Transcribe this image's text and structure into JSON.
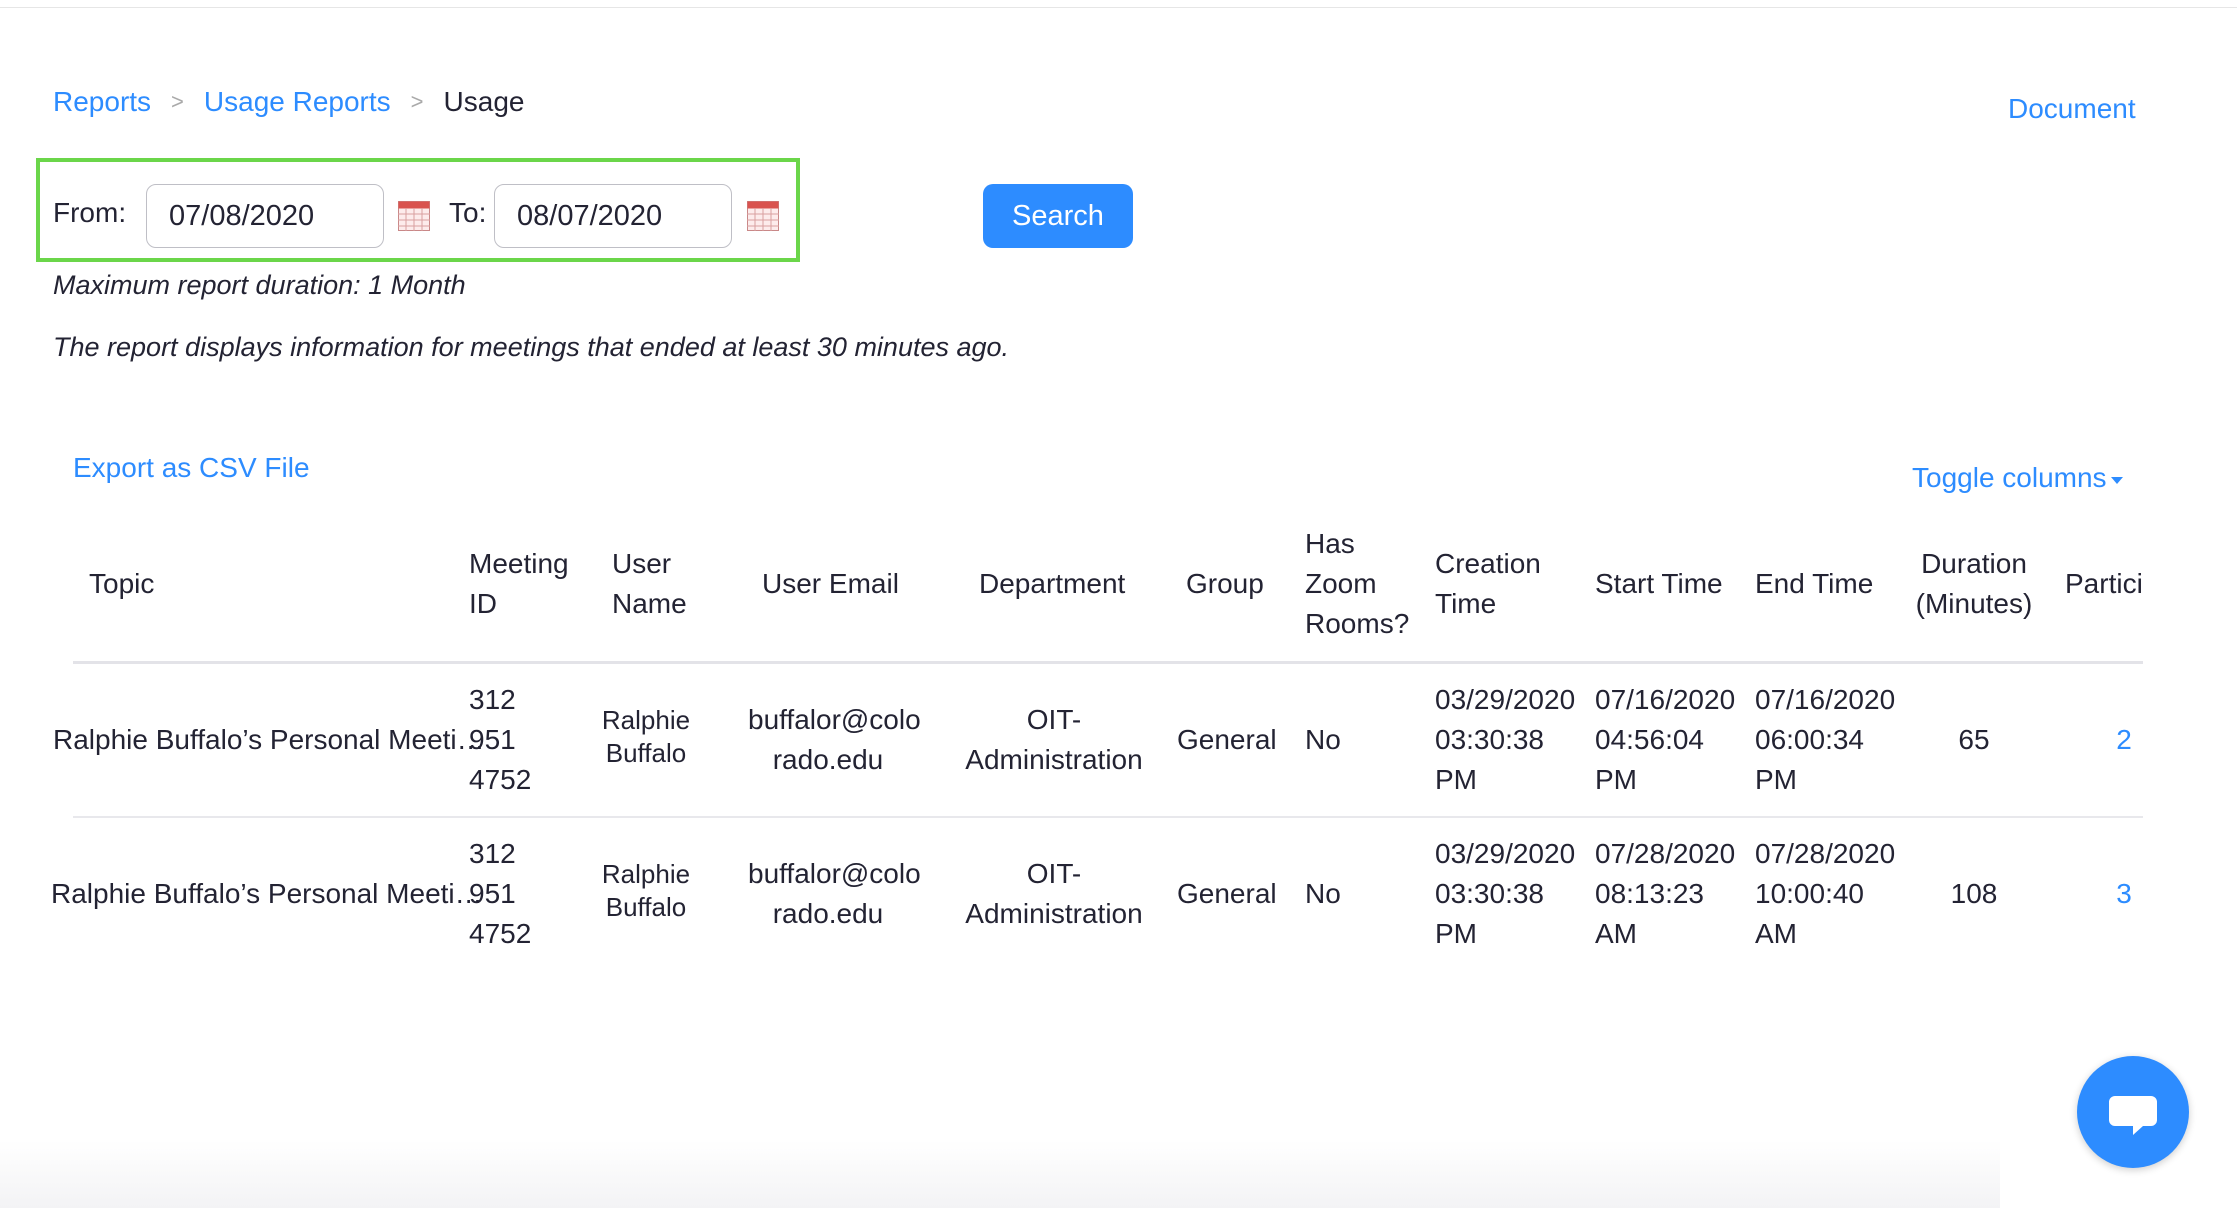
{
  "breadcrumb": {
    "reports": "Reports",
    "usage_reports": "Usage Reports",
    "current": "Usage",
    "separator": ">"
  },
  "document_link": "Document",
  "filter": {
    "from_label": "From:",
    "from_value": "07/08/2020",
    "to_label": "To:",
    "to_value": "08/07/2020",
    "search_label": "Search"
  },
  "notes": {
    "max_duration": "Maximum report duration: 1 Month",
    "ended_info": "The report displays information for meetings that ended at least 30 minutes ago."
  },
  "export_label": "Export as CSV File",
  "toggle_columns_label": "Toggle columns",
  "table": {
    "headers": {
      "topic": "Topic",
      "meeting_id": [
        "Meeting",
        "ID"
      ],
      "user_name": [
        "User",
        "Name"
      ],
      "user_email": "User Email",
      "department": "Department",
      "group": "Group",
      "has_zoom_rooms": [
        "Has",
        "Zoom",
        "Rooms?"
      ],
      "creation_time": [
        "Creation",
        "Time"
      ],
      "start_time": "Start Time",
      "end_time": "End Time",
      "duration": [
        "Duration",
        "(Minutes)"
      ],
      "participants": "Partici"
    },
    "rows": [
      {
        "topic": "Ralphie Buffalo’s Personal Meeti…",
        "meeting_id": [
          "312",
          "951",
          "4752"
        ],
        "user_name": [
          "Ralphie",
          "Buffalo"
        ],
        "user_email": [
          "buffalor@colo",
          "rado.edu"
        ],
        "department": [
          "OIT-",
          "Administration"
        ],
        "group": "General",
        "has_zoom_rooms": "No",
        "creation_time": [
          "03/29/2020",
          "03:30:38",
          "PM"
        ],
        "start_time": [
          "07/16/2020",
          "04:56:04",
          "PM"
        ],
        "end_time": [
          "07/16/2020",
          "06:00:34",
          "PM"
        ],
        "duration": "65",
        "participants": "2"
      },
      {
        "topic": "Ralphie Buffalo’s Personal Meeti…",
        "meeting_id": [
          "312",
          "951",
          "4752"
        ],
        "user_name": [
          "Ralphie",
          "Buffalo"
        ],
        "user_email": [
          "buffalor@colo",
          "rado.edu"
        ],
        "department": [
          "OIT-",
          "Administration"
        ],
        "group": "General",
        "has_zoom_rooms": "No",
        "creation_time": [
          "03/29/2020",
          "03:30:38",
          "PM"
        ],
        "start_time": [
          "07/28/2020",
          "08:13:23",
          "AM"
        ],
        "end_time": [
          "07/28/2020",
          "10:00:40",
          "AM"
        ],
        "duration": "108",
        "participants": "3"
      }
    ]
  },
  "icons": {
    "calendar": "calendar-icon",
    "chat": "chat-bubble-icon"
  },
  "colors": {
    "accent": "#2d8cff",
    "highlight_border": "#6bd64a",
    "text": "#232333"
  }
}
